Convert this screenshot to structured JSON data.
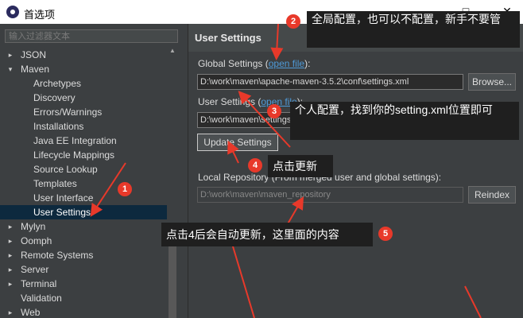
{
  "window": {
    "title": "首选项",
    "controls": [
      "□",
      "✕"
    ]
  },
  "filter": {
    "placeholder": "输入过滤器文本"
  },
  "tree": [
    {
      "label": "JSON",
      "twisty": "▸",
      "level": 0
    },
    {
      "label": "Maven",
      "twisty": "▾",
      "level": 0
    },
    {
      "label": "Archetypes",
      "twisty": "",
      "level": 1
    },
    {
      "label": "Discovery",
      "twisty": "",
      "level": 1
    },
    {
      "label": "Errors/Warnings",
      "twisty": "",
      "level": 1
    },
    {
      "label": "Installations",
      "twisty": "",
      "level": 1
    },
    {
      "label": "Java EE Integration",
      "twisty": "",
      "level": 1
    },
    {
      "label": "Lifecycle Mappings",
      "twisty": "",
      "level": 1
    },
    {
      "label": "Source Lookup",
      "twisty": "",
      "level": 1
    },
    {
      "label": "Templates",
      "twisty": "",
      "level": 1
    },
    {
      "label": "User Interface",
      "twisty": "",
      "level": 1
    },
    {
      "label": "User Settings",
      "twisty": "",
      "level": 1,
      "selected": true
    },
    {
      "label": "Mylyn",
      "twisty": "▸",
      "level": 0
    },
    {
      "label": "Oomph",
      "twisty": "▸",
      "level": 0
    },
    {
      "label": "Remote Systems",
      "twisty": "▸",
      "level": 0
    },
    {
      "label": "Server",
      "twisty": "▸",
      "level": 0
    },
    {
      "label": "Terminal",
      "twisty": "▸",
      "level": 0
    },
    {
      "label": "Validation",
      "twisty": "",
      "level": 0
    },
    {
      "label": "Web",
      "twisty": "▸",
      "level": 0
    }
  ],
  "page": {
    "title": "User Settings",
    "global_label": "Global Settings (",
    "global_link": "open file",
    "global_label_end": "):",
    "global_value": "D:\\work\\maven\\apache-maven-3.5.2\\conf\\settings.xml",
    "browse": "Browse...",
    "user_label": "User Settings (",
    "user_link": "open file",
    "user_label_end": "):",
    "user_value": "D:\\work\\maven\\settings.xml",
    "update_btn": "Update Settings",
    "local_label": "Local Repository (From merged user and global settings):",
    "local_value": "D:\\work\\maven\\maven_repository",
    "reindex": "Reindex"
  },
  "annotations": {
    "a1": {
      "num": "1"
    },
    "a2": {
      "num": "2",
      "text": "全局配置，也可以不配置，新手不要管"
    },
    "a3": {
      "num": "3",
      "text": "个人配置，找到你的setting.xml位置即可"
    },
    "a4": {
      "num": "4",
      "text": "点击更新"
    },
    "a5": {
      "num": "5",
      "text": "点击4后会自动更新，这里面的内容"
    }
  },
  "colors": {
    "arrow": "#e8392a",
    "badge": "#e8392a",
    "selection": "#0d293e",
    "link": "#4e9ad8"
  }
}
